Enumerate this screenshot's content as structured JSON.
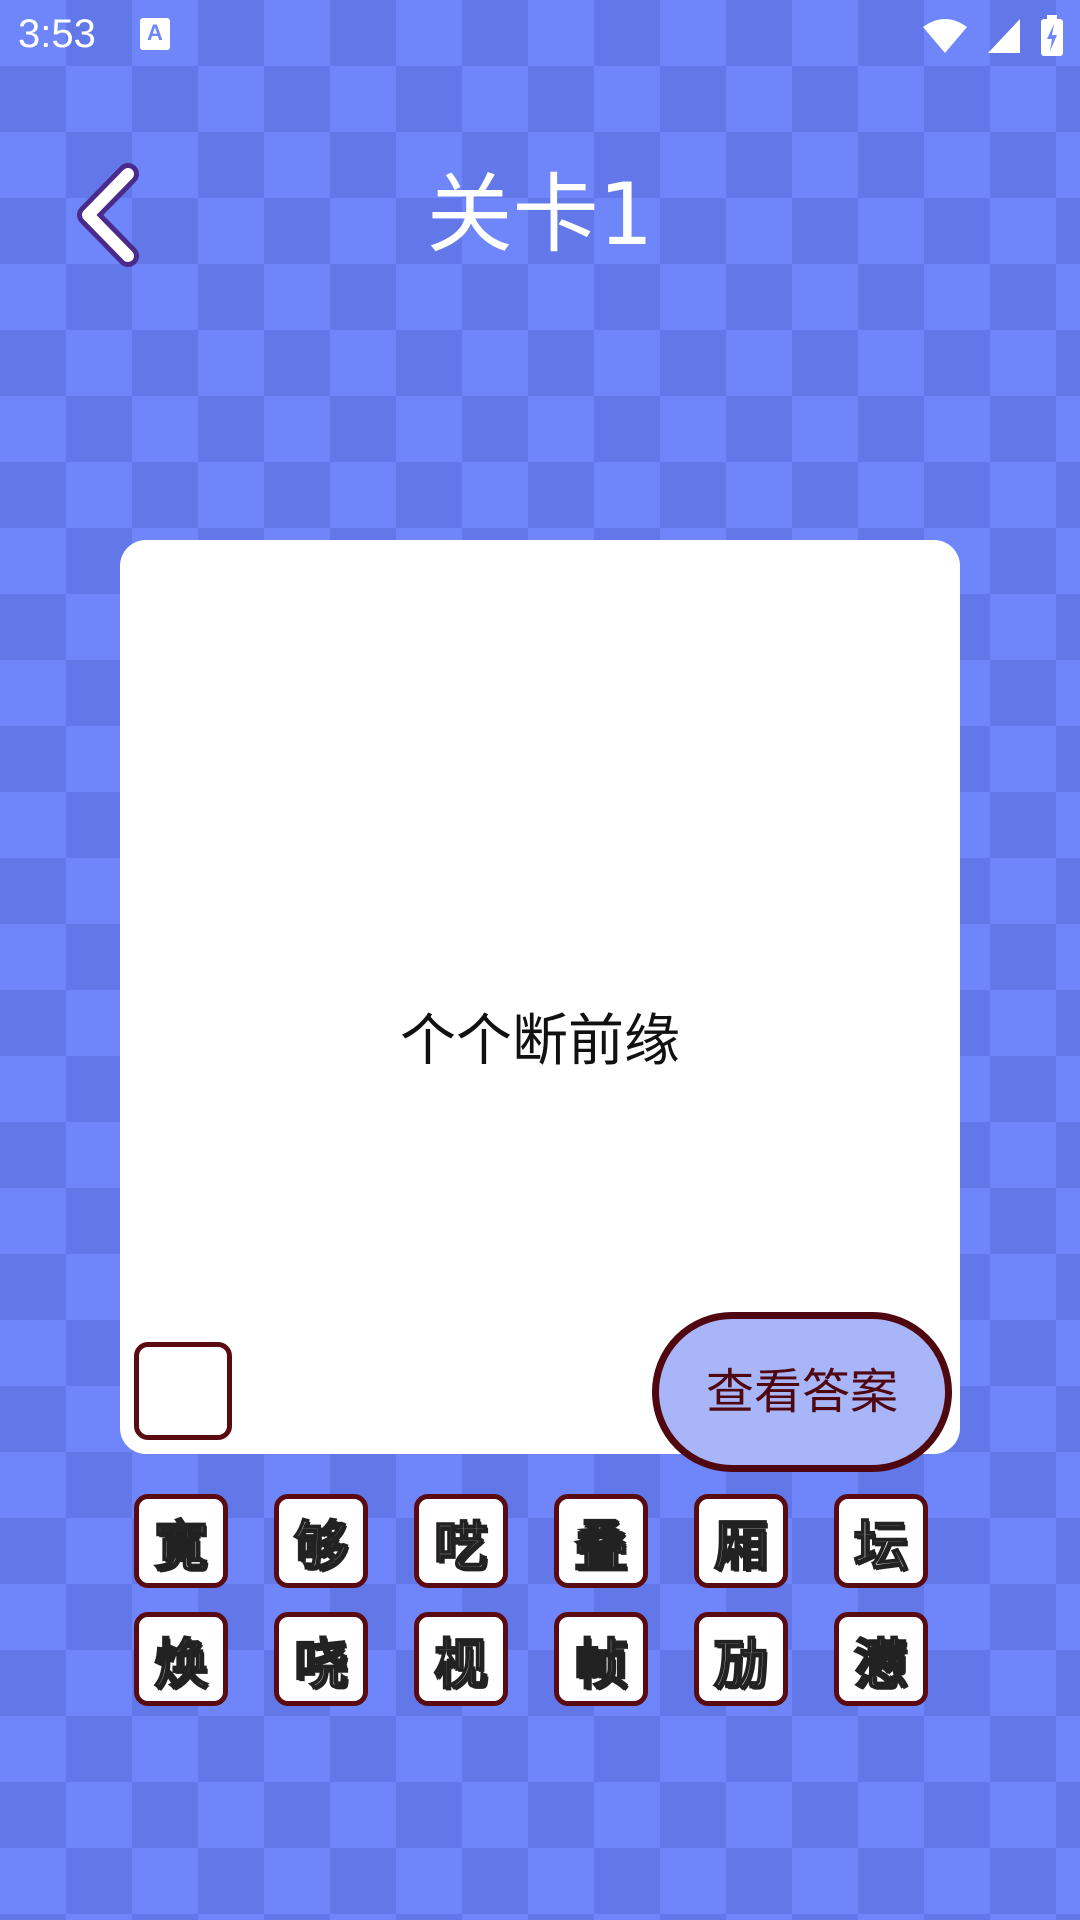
{
  "status_bar": {
    "time": "3:53",
    "notification_icon": "a-icon",
    "notification_label": "A",
    "icons": [
      "wifi-icon",
      "signal-icon",
      "battery-charging-icon"
    ]
  },
  "header": {
    "back_icon": "chevron-left-icon",
    "title": "关卡1"
  },
  "puzzle": {
    "clue": "个个断前缘",
    "answer_slot_count": 1,
    "view_answer_label": "查看答案"
  },
  "tiles": [
    [
      "寛",
      "够",
      "呓",
      "叠",
      "厢",
      "坛"
    ],
    [
      "焕",
      "哓",
      "枧",
      "帧",
      "劢",
      "懑"
    ]
  ],
  "colors": {
    "background": "#6f86fb",
    "background_pattern": "#6378e8",
    "accent_border": "#5a0b12",
    "button_fill": "#a8b5f8",
    "back_icon_stroke": "#4a2a8a"
  }
}
